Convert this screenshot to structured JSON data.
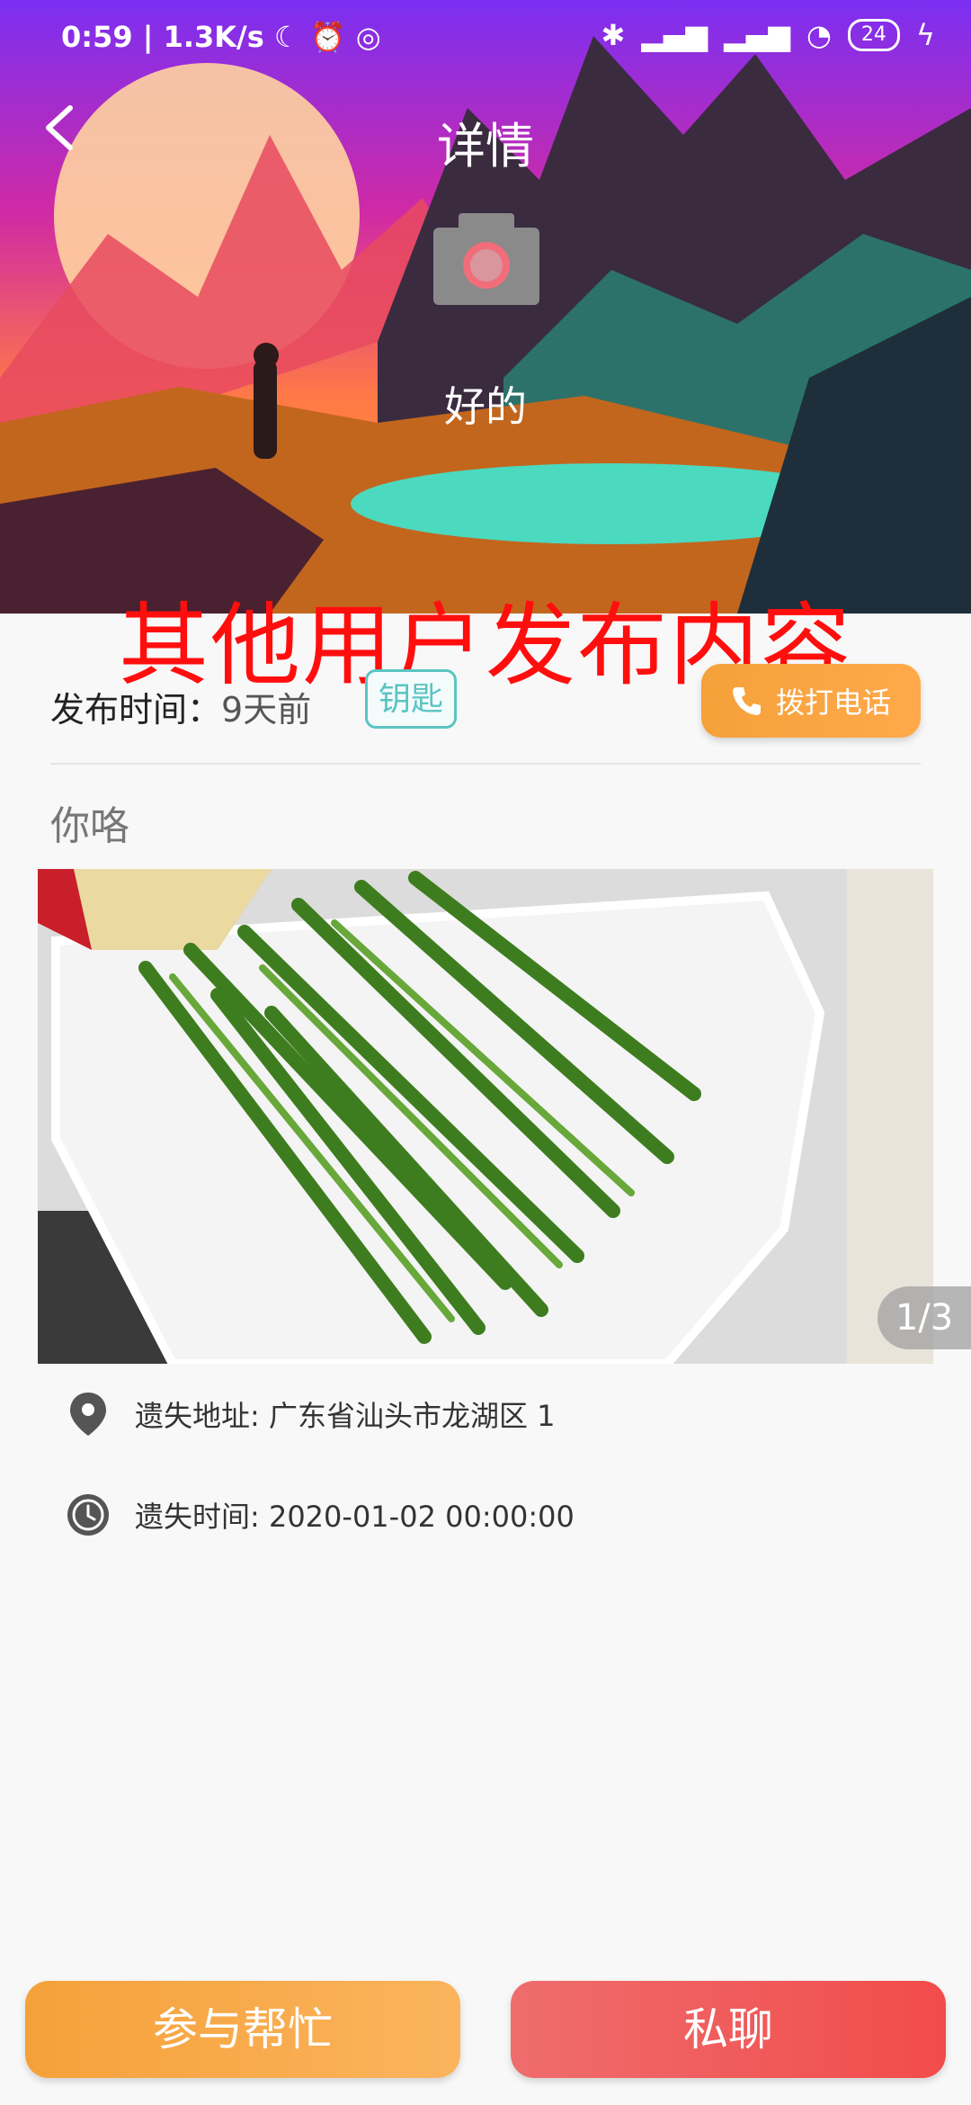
{
  "status_bar": {
    "time": "0:59",
    "speed": "1.3K/s",
    "battery": "24",
    "icons": [
      "moon-icon",
      "alarm-icon",
      "nfc-icon",
      "bluetooth-icon",
      "signal-hd-icon",
      "signal-icon",
      "wifi-icon",
      "battery-icon",
      "charging-icon"
    ]
  },
  "header": {
    "title": "详情",
    "back_icon": "chevron-left-icon"
  },
  "profile": {
    "avatar_icon": "camera-icon",
    "name": "好的"
  },
  "annotation": {
    "text": "其他用户发布内容",
    "color": "#ff0e0e"
  },
  "post": {
    "publish_label": "发布时间：",
    "publish_value": "9天前",
    "category": "钥匙",
    "call_button": "拨打电话",
    "content": "你咯",
    "image_pager": "1/3"
  },
  "details": {
    "address": "遗失地址: 广东省汕头市龙湖区 1",
    "time": "遗失时间: 2020-01-02 00:00:00"
  },
  "actions": {
    "help": "参与帮忙",
    "chat": "私聊"
  },
  "colors": {
    "accent_orange": "#f5a13a",
    "accent_red": "#f24b4b",
    "badge_teal": "#5bc4c2"
  }
}
